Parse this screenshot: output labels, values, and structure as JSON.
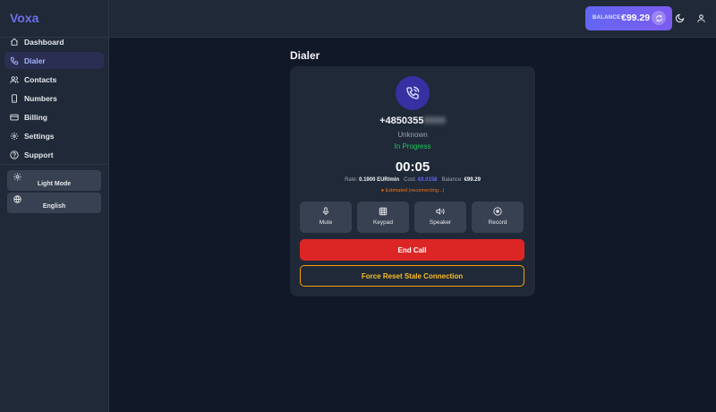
{
  "app": {
    "name": "Voxa"
  },
  "sidebar": {
    "items": [
      {
        "label": "Dashboard",
        "icon": "home-icon",
        "active": false
      },
      {
        "label": "Dialer",
        "icon": "phone-icon",
        "active": true
      },
      {
        "label": "Contacts",
        "icon": "users-icon",
        "active": false
      },
      {
        "label": "Numbers",
        "icon": "smartphone-icon",
        "active": false
      },
      {
        "label": "Billing",
        "icon": "credit-card-icon",
        "active": false
      },
      {
        "label": "Settings",
        "icon": "gear-icon",
        "active": false
      },
      {
        "label": "Support",
        "icon": "help-circle-icon",
        "active": false
      }
    ],
    "theme_toggle": {
      "label": "Light Mode",
      "icon": "sun-icon"
    },
    "language": {
      "label": "English",
      "icon": "globe-icon"
    }
  },
  "header": {
    "balance_label": "BALANCE",
    "balance_value": "€99.29"
  },
  "page": {
    "title": "Dialer"
  },
  "call": {
    "number_visible": "+4850355",
    "number_hidden": "0000",
    "caller_name": "Unknown",
    "status": "In Progress",
    "timer": "00:05",
    "rate_label": "Rate:",
    "rate_value": "0.1900 EUR/min",
    "cost_label": "Cost:",
    "cost_value": "€0.0158",
    "balance_label": "Balance:",
    "balance_value": "€99.29",
    "estimate_note": "● Estimated (reconnecting...)"
  },
  "controls": [
    {
      "label": "Mute",
      "icon": "microphone-icon"
    },
    {
      "label": "Keypad",
      "icon": "keypad-icon"
    },
    {
      "label": "Speaker",
      "icon": "speaker-icon"
    },
    {
      "label": "Record",
      "icon": "record-icon"
    }
  ],
  "actions": {
    "end_call": "End Call",
    "force_reset": "Force Reset Stale Connection"
  },
  "colors": {
    "accent": "#6366f1",
    "danger": "#dc2626",
    "warning": "#f59e0b",
    "success": "#22c55e"
  }
}
